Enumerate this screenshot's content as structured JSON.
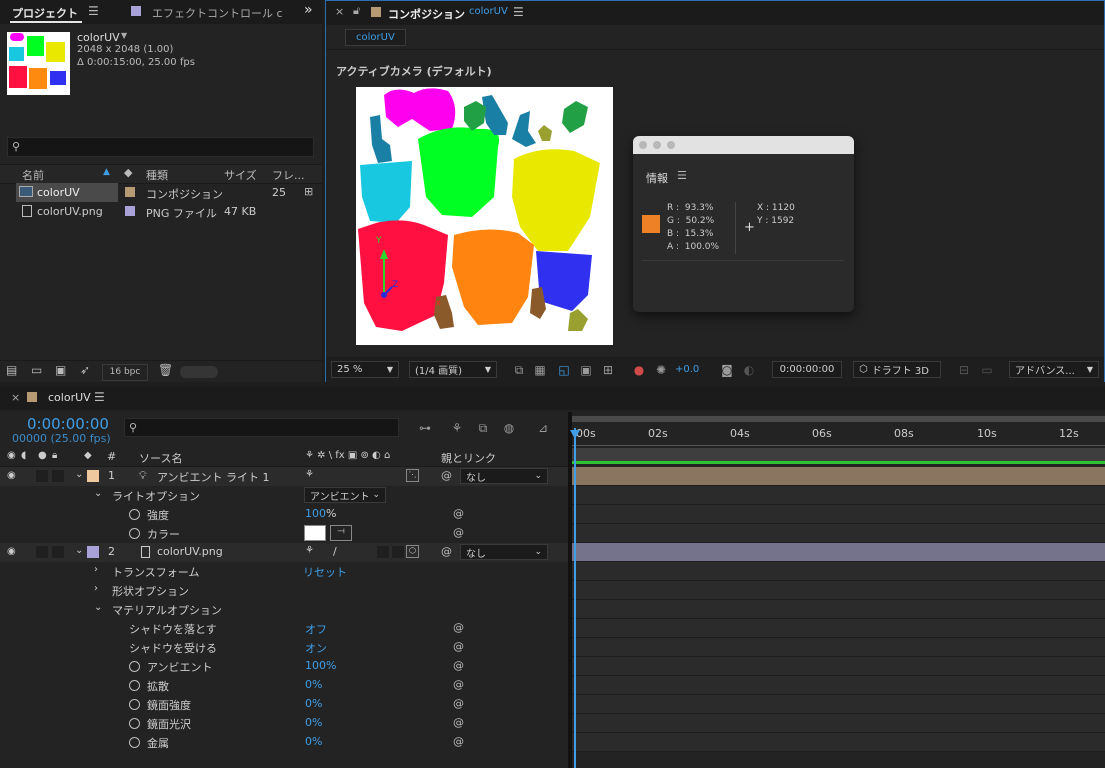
{
  "project_panel": {
    "tab_project": "プロジェクト",
    "tab_effects": "エフェクトコントロール c",
    "comp_name": "colorUV",
    "comp_dims": "2048 x 2048 (1.00)",
    "comp_duration": "Δ 0:00:15:00, 25.00 fps",
    "search_placeholder": "",
    "col_name": "名前",
    "col_type": "種類",
    "col_size": "サイズ",
    "col_frame": "フレ...",
    "items": [
      {
        "name": "colorUV",
        "type": "コンポジション",
        "size": "",
        "frame": "25",
        "color": "#b59a73"
      },
      {
        "name": "colorUV.png",
        "type": "PNG ファイル",
        "size": "47 KB",
        "frame": "",
        "color": "#a9a2d9"
      }
    ],
    "bpc": "16 bpc"
  },
  "comp_panel": {
    "close": "×",
    "title": "コンポジション",
    "title_link": "colorUV",
    "tab": "colorUV",
    "camera_label": "アクティブカメラ (デフォルト)",
    "zoom": "25 %",
    "resolution": "(1/4 画質)",
    "exposure": "+0.0",
    "timecode": "0:00:00:00",
    "draft3d": "ドラフト 3D",
    "advanced": "アドバンス..."
  },
  "info_panel": {
    "title": "情報",
    "r": "R :  93.3%",
    "g": "G :  50.2%",
    "b": "B :  15.3%",
    "a": "A :  100.0%",
    "x": "X : 1120",
    "y": "Y : 1592",
    "swatch": "#ee8026"
  },
  "timeline": {
    "tab": "colorUV",
    "time": "0:00:00:00",
    "frames": "00000 (25.00 fps)",
    "col_source": "ソース名",
    "col_parent": "親とリンク",
    "switch_icons": "⚘ ✲ \\ fx ▣ ⊚ ◐ ⌂",
    "ticks": [
      "00s",
      "02s",
      "04s",
      "06s",
      "08s",
      "10s",
      "12s"
    ],
    "layers": [
      {
        "num": "1",
        "name": "アンビエント ライト 1",
        "parent": "なし",
        "color": "#f0c8a0"
      },
      {
        "num": "2",
        "name": "colorUV.png",
        "parent": "なし",
        "color": "#a9a2d9"
      }
    ],
    "light_options": "ライトオプション",
    "light_type": "アンビエント",
    "intensity_label": "強度",
    "intensity_value": "100",
    "pct": "%",
    "color_label": "カラー",
    "transform": "トランスフォーム",
    "reset": "リセット",
    "geometry": "形状オプション",
    "material": "マテリアルオプション",
    "props": [
      {
        "label": "シャドウを落とす",
        "value": "オフ",
        "stopwatch": false
      },
      {
        "label": "シャドウを受ける",
        "value": "オン",
        "stopwatch": false
      },
      {
        "label": "アンビエント",
        "value": "100%",
        "stopwatch": true
      },
      {
        "label": "拡散",
        "value": "0%",
        "stopwatch": true
      },
      {
        "label": "鏡面強度",
        "value": "0%",
        "stopwatch": true
      },
      {
        "label": "鏡面光沢",
        "value": "0%",
        "stopwatch": true
      },
      {
        "label": "金属",
        "value": "0%",
        "stopwatch": true
      }
    ]
  }
}
